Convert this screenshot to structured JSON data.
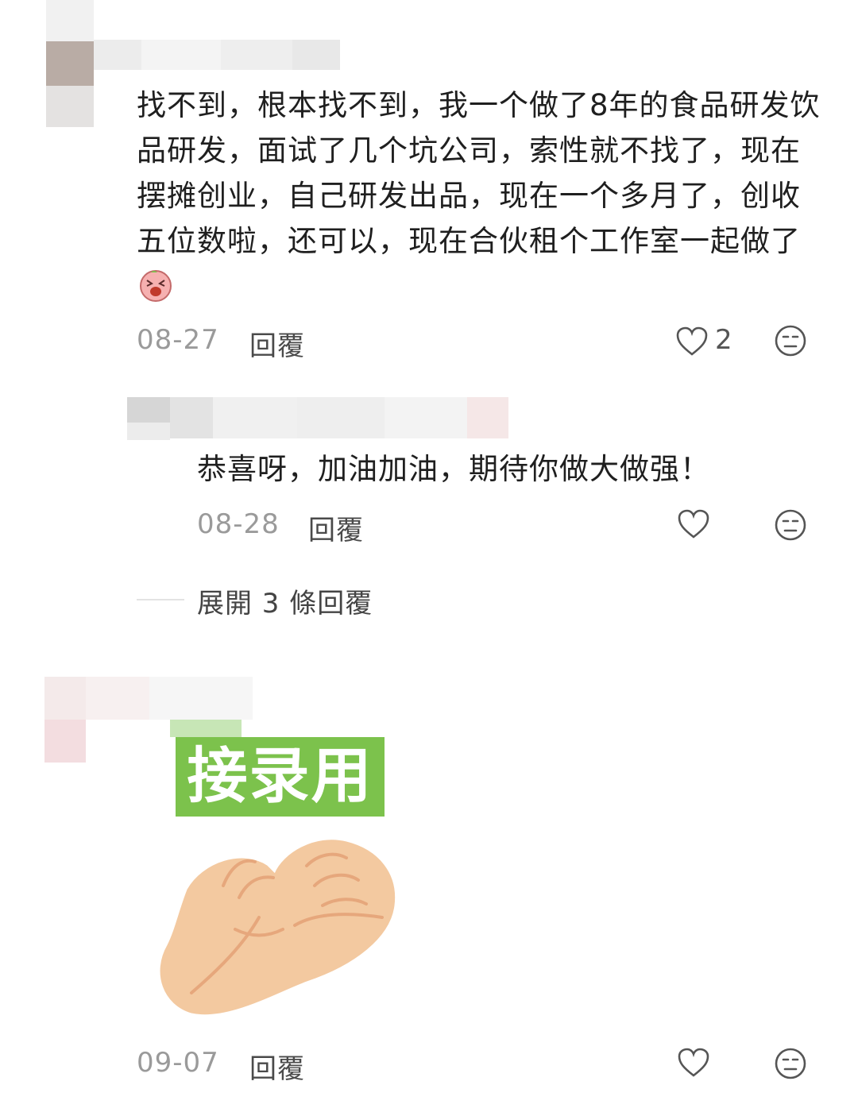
{
  "comments": [
    {
      "text": "找不到，根本找不到，我一个做了8年的食品研发饮品研发，面试了几个坑公司，索性就不找了，现在摆摊创业，自己研发出品，现在一个多月了，创收五位数啦，还可以，现在合伙租个工作室一起做了",
      "date": "08-27",
      "reply_label": "回覆",
      "likes": "2",
      "replies": [
        {
          "text": "恭喜呀，加油加油，期待你做大做强！",
          "date": "08-28",
          "reply_label": "回覆"
        }
      ],
      "expand_label": "展開 3 條回覆"
    },
    {
      "sticker_text": "接录用",
      "date": "09-07",
      "reply_label": "回覆"
    }
  ],
  "icons": {
    "like": "heart-outline-icon",
    "dislike": "neutral-face-icon",
    "emoji": "laughing-face-emoji"
  },
  "colors": {
    "sticker_green": "#7cc24c",
    "hand_skin": "#f3c9a0"
  }
}
